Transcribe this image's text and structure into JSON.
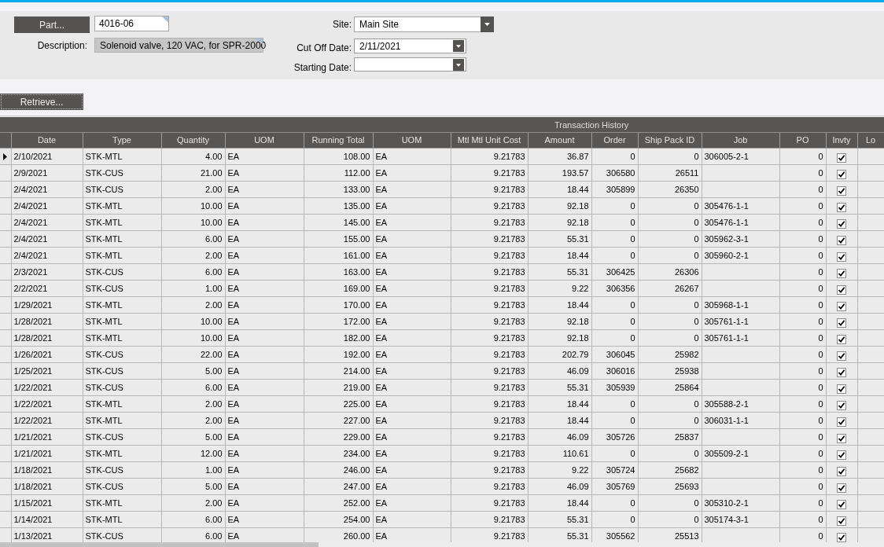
{
  "form": {
    "part_button": "Part...",
    "part_number": "4016-06",
    "description_label": "Description:",
    "description": "Solenoid valve, 120 VAC, for SPR-2000",
    "site_label": "Site:",
    "site": "Main Site",
    "cut_off_date_label": "Cut Off Date:",
    "cut_off_date": "2/11/2021",
    "starting_date_label": "Starting Date:"
  },
  "retrieve_button": "Retrieve...",
  "table": {
    "title": "Transaction History",
    "columns": [
      {
        "label": "Date",
        "kind": "text"
      },
      {
        "label": "Type",
        "kind": "text"
      },
      {
        "label": "Quantity",
        "kind": "text"
      },
      {
        "label": "UOM",
        "kind": "text"
      },
      {
        "label": "Running Total",
        "kind": "text"
      },
      {
        "label": "UOM",
        "kind": "text"
      },
      {
        "label": "Mtl Mtl Unit Cost",
        "kind": "text"
      },
      {
        "label": "Amount",
        "kind": "text"
      },
      {
        "label": "Order",
        "kind": "text"
      },
      {
        "label": "Ship Pack ID",
        "kind": "text"
      },
      {
        "label": "Job",
        "kind": "text"
      },
      {
        "label": "PO",
        "kind": "text"
      },
      {
        "label": "Invty",
        "kind": "check"
      },
      {
        "label": "Lo",
        "kind": "text"
      }
    ],
    "rows": [
      {
        "selected": true,
        "date": "2/10/2021",
        "type": "STK-MTL",
        "quantity": "4.00",
        "uom": "EA",
        "running_total": "108.00",
        "uom_2": "EA",
        "unit_cost": "9.21783",
        "amount": "36.87",
        "order": "0",
        "ship_pack_id": "0",
        "job": "306005-2-1",
        "po": "0",
        "invty": true
      },
      {
        "selected": false,
        "date": "2/9/2021",
        "type": "STK-CUS",
        "quantity": "21.00",
        "uom": "EA",
        "running_total": "112.00",
        "uom_2": "EA",
        "unit_cost": "9.21783",
        "amount": "193.57",
        "order": "306580",
        "ship_pack_id": "26511",
        "po": "0",
        "invty": true
      },
      {
        "selected": false,
        "date": "2/4/2021",
        "type": "STK-CUS",
        "quantity": "2.00",
        "uom": "EA",
        "running_total": "133.00",
        "uom_2": "EA",
        "unit_cost": "9.21783",
        "amount": "18.44",
        "order": "305899",
        "ship_pack_id": "26350",
        "po": "0",
        "invty": true
      },
      {
        "selected": false,
        "date": "2/4/2021",
        "type": "STK-MTL",
        "quantity": "10.00",
        "uom": "EA",
        "running_total": "135.00",
        "uom_2": "EA",
        "unit_cost": "9.21783",
        "amount": "92.18",
        "order": "0",
        "ship_pack_id": "0",
        "job": "305476-1-1",
        "po": "0",
        "invty": true
      },
      {
        "selected": false,
        "date": "2/4/2021",
        "type": "STK-MTL",
        "quantity": "10.00",
        "uom": "EA",
        "running_total": "145.00",
        "uom_2": "EA",
        "unit_cost": "9.21783",
        "amount": "92.18",
        "order": "0",
        "ship_pack_id": "0",
        "job": "305476-1-1",
        "po": "0",
        "invty": true
      },
      {
        "selected": false,
        "date": "2/4/2021",
        "type": "STK-MTL",
        "quantity": "6.00",
        "uom": "EA",
        "running_total": "155.00",
        "uom_2": "EA",
        "unit_cost": "9.21783",
        "amount": "55.31",
        "order": "0",
        "ship_pack_id": "0",
        "job": "305962-3-1",
        "po": "0",
        "invty": true
      },
      {
        "selected": false,
        "date": "2/4/2021",
        "type": "STK-MTL",
        "quantity": "2.00",
        "uom": "EA",
        "running_total": "161.00",
        "uom_2": "EA",
        "unit_cost": "9.21783",
        "amount": "18.44",
        "order": "0",
        "ship_pack_id": "0",
        "job": "305960-2-1",
        "po": "0",
        "invty": true
      },
      {
        "selected": false,
        "date": "2/3/2021",
        "type": "STK-CUS",
        "quantity": "6.00",
        "uom": "EA",
        "running_total": "163.00",
        "uom_2": "EA",
        "unit_cost": "9.21783",
        "amount": "55.31",
        "order": "306425",
        "ship_pack_id": "26306",
        "po": "0",
        "invty": true
      },
      {
        "selected": false,
        "date": "2/2/2021",
        "type": "STK-CUS",
        "quantity": "1.00",
        "uom": "EA",
        "running_total": "169.00",
        "uom_2": "EA",
        "unit_cost": "9.21783",
        "amount": "9.22",
        "order": "306356",
        "ship_pack_id": "26267",
        "po": "0",
        "invty": true
      },
      {
        "selected": false,
        "date": "1/29/2021",
        "type": "STK-MTL",
        "quantity": "2.00",
        "uom": "EA",
        "running_total": "170.00",
        "uom_2": "EA",
        "unit_cost": "9.21783",
        "amount": "18.44",
        "order": "0",
        "ship_pack_id": "0",
        "job": "305968-1-1",
        "po": "0",
        "invty": true
      },
      {
        "selected": false,
        "date": "1/28/2021",
        "type": "STK-MTL",
        "quantity": "10.00",
        "uom": "EA",
        "running_total": "172.00",
        "uom_2": "EA",
        "unit_cost": "9.21783",
        "amount": "92.18",
        "order": "0",
        "ship_pack_id": "0",
        "job": "305761-1-1",
        "po": "0",
        "invty": true
      },
      {
        "selected": false,
        "date": "1/28/2021",
        "type": "STK-MTL",
        "quantity": "10.00",
        "uom": "EA",
        "running_total": "182.00",
        "uom_2": "EA",
        "unit_cost": "9.21783",
        "amount": "92.18",
        "order": "0",
        "ship_pack_id": "0",
        "job": "305761-1-1",
        "po": "0",
        "invty": true
      },
      {
        "selected": false,
        "date": "1/26/2021",
        "type": "STK-CUS",
        "quantity": "22.00",
        "uom": "EA",
        "running_total": "192.00",
        "uom_2": "EA",
        "unit_cost": "9.21783",
        "amount": "202.79",
        "order": "306045",
        "ship_pack_id": "25982",
        "po": "0",
        "invty": true
      },
      {
        "selected": false,
        "date": "1/25/2021",
        "type": "STK-CUS",
        "quantity": "5.00",
        "uom": "EA",
        "running_total": "214.00",
        "uom_2": "EA",
        "unit_cost": "9.21783",
        "amount": "46.09",
        "order": "306016",
        "ship_pack_id": "25938",
        "po": "0",
        "invty": true
      },
      {
        "selected": false,
        "date": "1/22/2021",
        "type": "STK-CUS",
        "quantity": "6.00",
        "uom": "EA",
        "running_total": "219.00",
        "uom_2": "EA",
        "unit_cost": "9.21783",
        "amount": "55.31",
        "order": "305939",
        "ship_pack_id": "25864",
        "po": "0",
        "invty": true
      },
      {
        "selected": false,
        "date": "1/22/2021",
        "type": "STK-MTL",
        "quantity": "2.00",
        "uom": "EA",
        "running_total": "225.00",
        "uom_2": "EA",
        "unit_cost": "9.21783",
        "amount": "18.44",
        "order": "0",
        "ship_pack_id": "0",
        "job": "305588-2-1",
        "po": "0",
        "invty": true
      },
      {
        "selected": false,
        "date": "1/22/2021",
        "type": "STK-MTL",
        "quantity": "2.00",
        "uom": "EA",
        "running_total": "227.00",
        "uom_2": "EA",
        "unit_cost": "9.21783",
        "amount": "18.44",
        "order": "0",
        "ship_pack_id": "0",
        "job": "306031-1-1",
        "po": "0",
        "invty": true
      },
      {
        "selected": false,
        "date": "1/21/2021",
        "type": "STK-CUS",
        "quantity": "5.00",
        "uom": "EA",
        "running_total": "229.00",
        "uom_2": "EA",
        "unit_cost": "9.21783",
        "amount": "46.09",
        "order": "305726",
        "ship_pack_id": "25837",
        "po": "0",
        "invty": true
      },
      {
        "selected": false,
        "date": "1/21/2021",
        "type": "STK-MTL",
        "quantity": "12.00",
        "uom": "EA",
        "running_total": "234.00",
        "uom_2": "EA",
        "unit_cost": "9.21783",
        "amount": "110.61",
        "order": "0",
        "ship_pack_id": "0",
        "job": "305509-2-1",
        "po": "0",
        "invty": true
      },
      {
        "selected": false,
        "date": "1/18/2021",
        "type": "STK-CUS",
        "quantity": "1.00",
        "uom": "EA",
        "running_total": "246.00",
        "uom_2": "EA",
        "unit_cost": "9.21783",
        "amount": "9.22",
        "order": "305724",
        "ship_pack_id": "25682",
        "po": "0",
        "invty": true
      },
      {
        "selected": false,
        "date": "1/18/2021",
        "type": "STK-CUS",
        "quantity": "5.00",
        "uom": "EA",
        "running_total": "247.00",
        "uom_2": "EA",
        "unit_cost": "9.21783",
        "amount": "46.09",
        "order": "305769",
        "ship_pack_id": "25693",
        "po": "0",
        "invty": true
      },
      {
        "selected": false,
        "date": "1/15/2021",
        "type": "STK-MTL",
        "quantity": "2.00",
        "uom": "EA",
        "running_total": "252.00",
        "uom_2": "EA",
        "unit_cost": "9.21783",
        "amount": "18.44",
        "order": "0",
        "ship_pack_id": "0",
        "job": "305310-2-1",
        "po": "0",
        "invty": true
      },
      {
        "selected": false,
        "date": "1/14/2021",
        "type": "STK-MTL",
        "quantity": "6.00",
        "uom": "EA",
        "running_total": "254.00",
        "uom_2": "EA",
        "unit_cost": "9.21783",
        "amount": "55.31",
        "order": "0",
        "ship_pack_id": "0",
        "job": "305174-3-1",
        "po": "0",
        "invty": true
      },
      {
        "selected": false,
        "date": "1/13/2021",
        "type": "STK-CUS",
        "quantity": "6.00",
        "uom": "EA",
        "running_total": "260.00",
        "uom_2": "EA",
        "unit_cost": "9.21783",
        "amount": "55.31",
        "order": "305562",
        "ship_pack_id": "25513",
        "po": "0",
        "invty": true
      }
    ]
  }
}
